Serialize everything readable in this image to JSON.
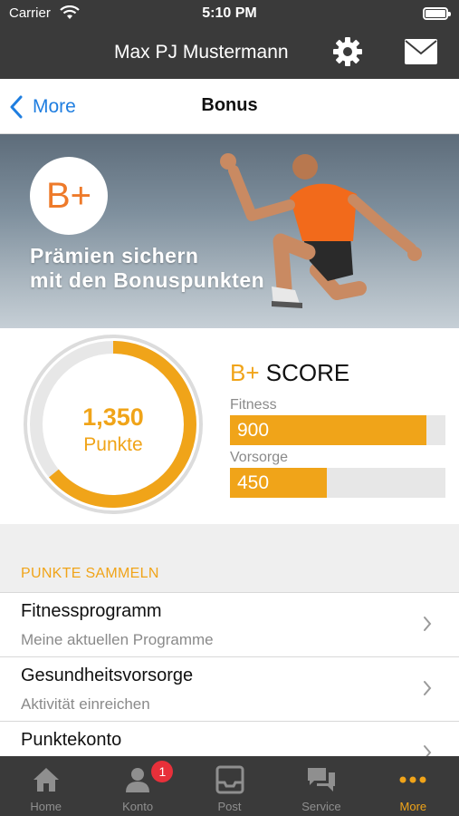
{
  "status_bar": {
    "carrier": "Carrier",
    "time": "5:10 PM"
  },
  "top_bar": {
    "user_name": "Max PJ Mustermann",
    "settings_icon": "gear-icon",
    "mail_icon": "envelope-icon"
  },
  "nav": {
    "back_label": "More",
    "title": "Bonus"
  },
  "hero": {
    "badge": "B+",
    "line1": "Prämien sichern",
    "line2": "mit den Bonuspunkten"
  },
  "score": {
    "ring_value": "1,350",
    "ring_unit": "Punkte",
    "ring_fraction": 0.64,
    "title_prefix": "B+",
    "title_suffix": "SCORE",
    "bars": [
      {
        "label": "Fitness",
        "value": "900",
        "fraction": 0.91
      },
      {
        "label": "Vorsorge",
        "value": "450",
        "fraction": 0.45
      }
    ]
  },
  "section": {
    "title": "PUNKTE SAMMELN"
  },
  "list": [
    {
      "title": "Fitnessprogramm",
      "subtitle": "Meine aktuellen Programme"
    },
    {
      "title": "Gesundheitsvorsorge",
      "subtitle": "Aktivität einreichen"
    },
    {
      "title": "Punktekonto",
      "subtitle": ""
    }
  ],
  "tabs": [
    {
      "label": "Home",
      "icon": "home-icon",
      "badge": ""
    },
    {
      "label": "Konto",
      "icon": "person-icon",
      "badge": "1"
    },
    {
      "label": "Post",
      "icon": "inbox-icon",
      "badge": ""
    },
    {
      "label": "Service",
      "icon": "chat-icon",
      "badge": ""
    },
    {
      "label": "More",
      "icon": "more-icon",
      "badge": ""
    }
  ],
  "colors": {
    "accent": "#f0a419",
    "link": "#1f7ee0",
    "dark_bar": "#3a3a3a",
    "badge_red": "#e8303a",
    "hero_orange": "#ee7a2a"
  }
}
